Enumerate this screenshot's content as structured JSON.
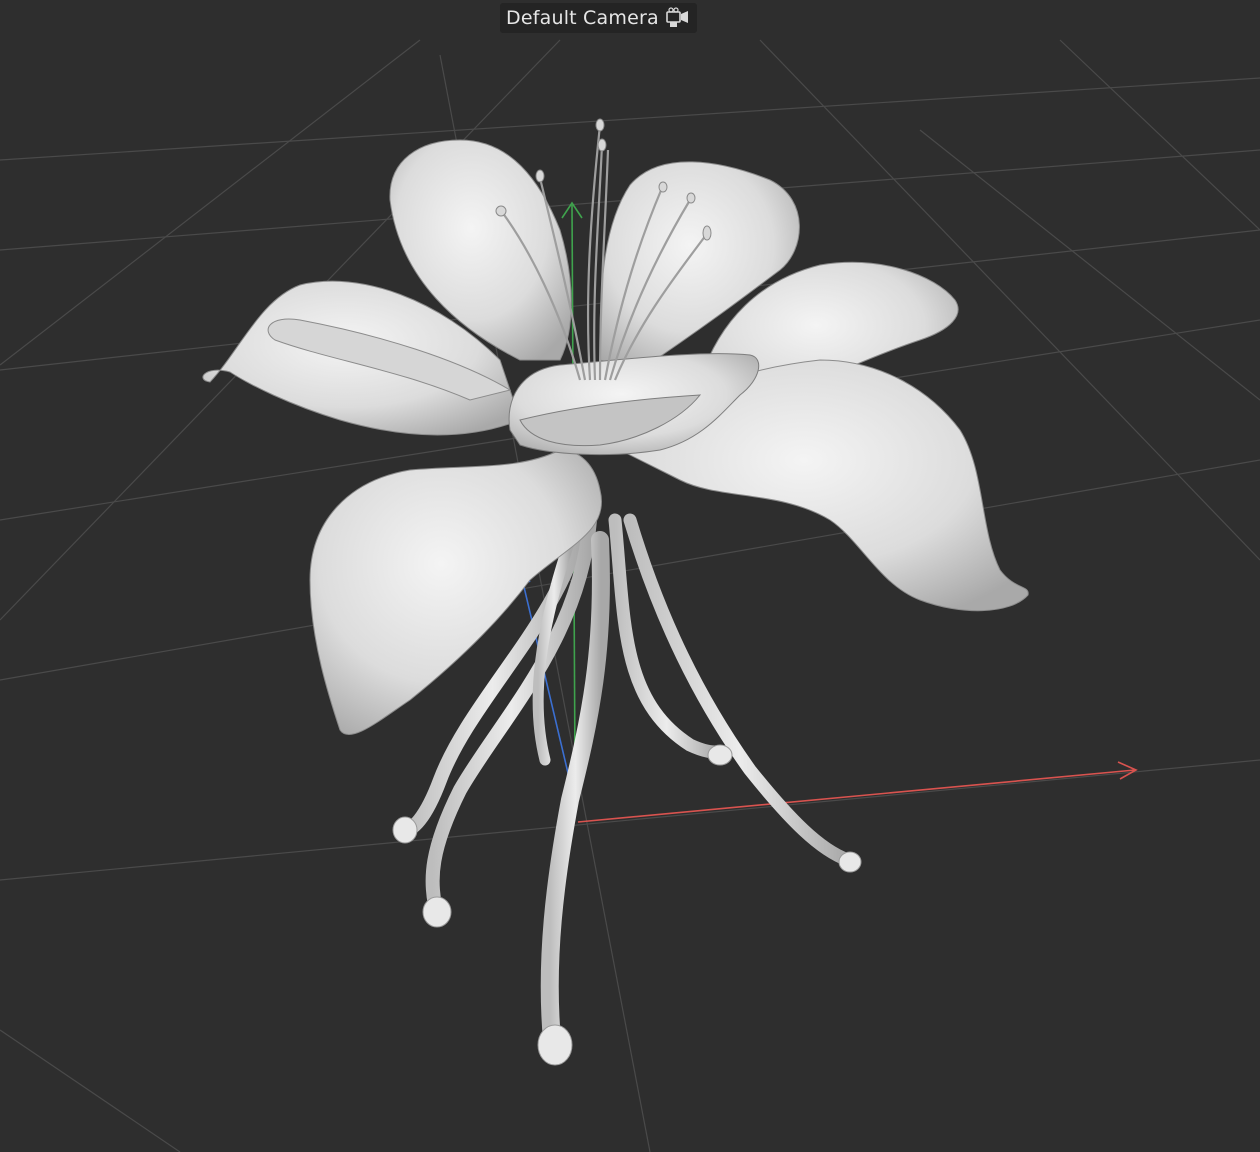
{
  "viewport": {
    "camera_label": "Default Camera",
    "camera_icon": "camera-icon",
    "background_color": "#2e2e2e",
    "grid_color": "#4a4a4a",
    "axis_colors": {
      "x": "#d9534f",
      "y": "#3fa34d",
      "z": "#3b6fd1"
    },
    "model_color": "#e6e6e6",
    "grid_visible": true
  }
}
